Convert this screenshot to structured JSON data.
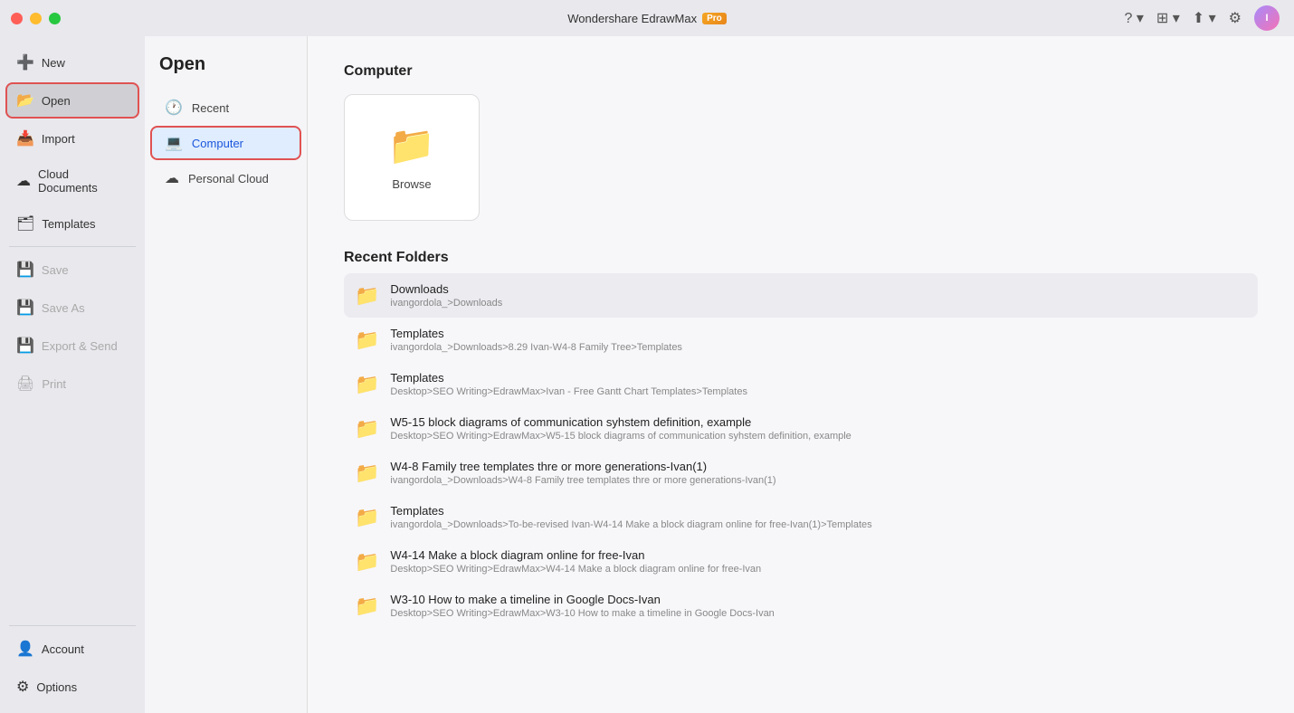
{
  "titlebar": {
    "app_name": "Wondershare EdrawMax",
    "pro_label": "Pro",
    "avatar_initials": "I"
  },
  "header_icons": {
    "help": "?",
    "grid": "⊞",
    "share": "↑",
    "settings": "⚙"
  },
  "sidebar": {
    "items": [
      {
        "id": "new",
        "label": "New",
        "icon": "➕"
      },
      {
        "id": "open",
        "label": "Open",
        "icon": "📂",
        "active": true
      },
      {
        "id": "import",
        "label": "Import",
        "icon": "📥"
      },
      {
        "id": "cloud",
        "label": "Cloud Documents",
        "icon": "☁"
      },
      {
        "id": "templates",
        "label": "Templates",
        "icon": "🗂"
      },
      {
        "id": "save",
        "label": "Save",
        "icon": "💾",
        "disabled": true
      },
      {
        "id": "saveas",
        "label": "Save As",
        "icon": "💾",
        "disabled": true
      },
      {
        "id": "export",
        "label": "Export & Send",
        "icon": "💾",
        "disabled": true
      },
      {
        "id": "print",
        "label": "Print",
        "icon": "🖨",
        "disabled": true
      }
    ],
    "bottom_items": [
      {
        "id": "account",
        "label": "Account",
        "icon": "👤"
      },
      {
        "id": "options",
        "label": "Options",
        "icon": "⚙"
      }
    ]
  },
  "left_panel": {
    "title": "Open",
    "items": [
      {
        "id": "recent",
        "label": "Recent",
        "icon": "🕐"
      },
      {
        "id": "computer",
        "label": "Computer",
        "icon": "💻",
        "active": true
      },
      {
        "id": "personal_cloud",
        "label": "Personal Cloud",
        "icon": "☁"
      }
    ]
  },
  "main": {
    "computer_section": {
      "title": "Computer",
      "browse_label": "Browse"
    },
    "recent_folders": {
      "title": "Recent Folders",
      "items": [
        {
          "name": "Downloads",
          "path": "ivangordola_>Downloads",
          "highlighted": true
        },
        {
          "name": "Templates",
          "path": "ivangordola_>Downloads>8.29 Ivan-W4-8 Family Tree>Templates",
          "highlighted": false
        },
        {
          "name": "Templates",
          "path": "Desktop>SEO Writing>EdrawMax>Ivan - Free Gantt Chart Templates>Templates",
          "highlighted": false
        },
        {
          "name": "W5-15 block diagrams of communication syhstem definition, example",
          "path": "Desktop>SEO Writing>EdrawMax>W5-15 block diagrams of communication syhstem definition, example",
          "highlighted": false
        },
        {
          "name": "W4-8 Family tree templates thre or more generations-Ivan(1)",
          "path": "ivangordola_>Downloads>W4-8 Family tree templates thre or more generations-Ivan(1)",
          "highlighted": false
        },
        {
          "name": "Templates",
          "path": "ivangordola_>Downloads>To-be-revised Ivan-W4-14 Make a block diagram online for free-Ivan(1)>Templates",
          "highlighted": false
        },
        {
          "name": "W4-14 Make a block diagram online for free-Ivan",
          "path": "Desktop>SEO Writing>EdrawMax>W4-14 Make a block diagram online for free-Ivan",
          "highlighted": false
        },
        {
          "name": "W3-10 How to make a timeline in Google Docs-Ivan",
          "path": "Desktop>SEO Writing>EdrawMax>W3-10 How to make a timeline in Google Docs-Ivan",
          "highlighted": false
        }
      ]
    }
  }
}
